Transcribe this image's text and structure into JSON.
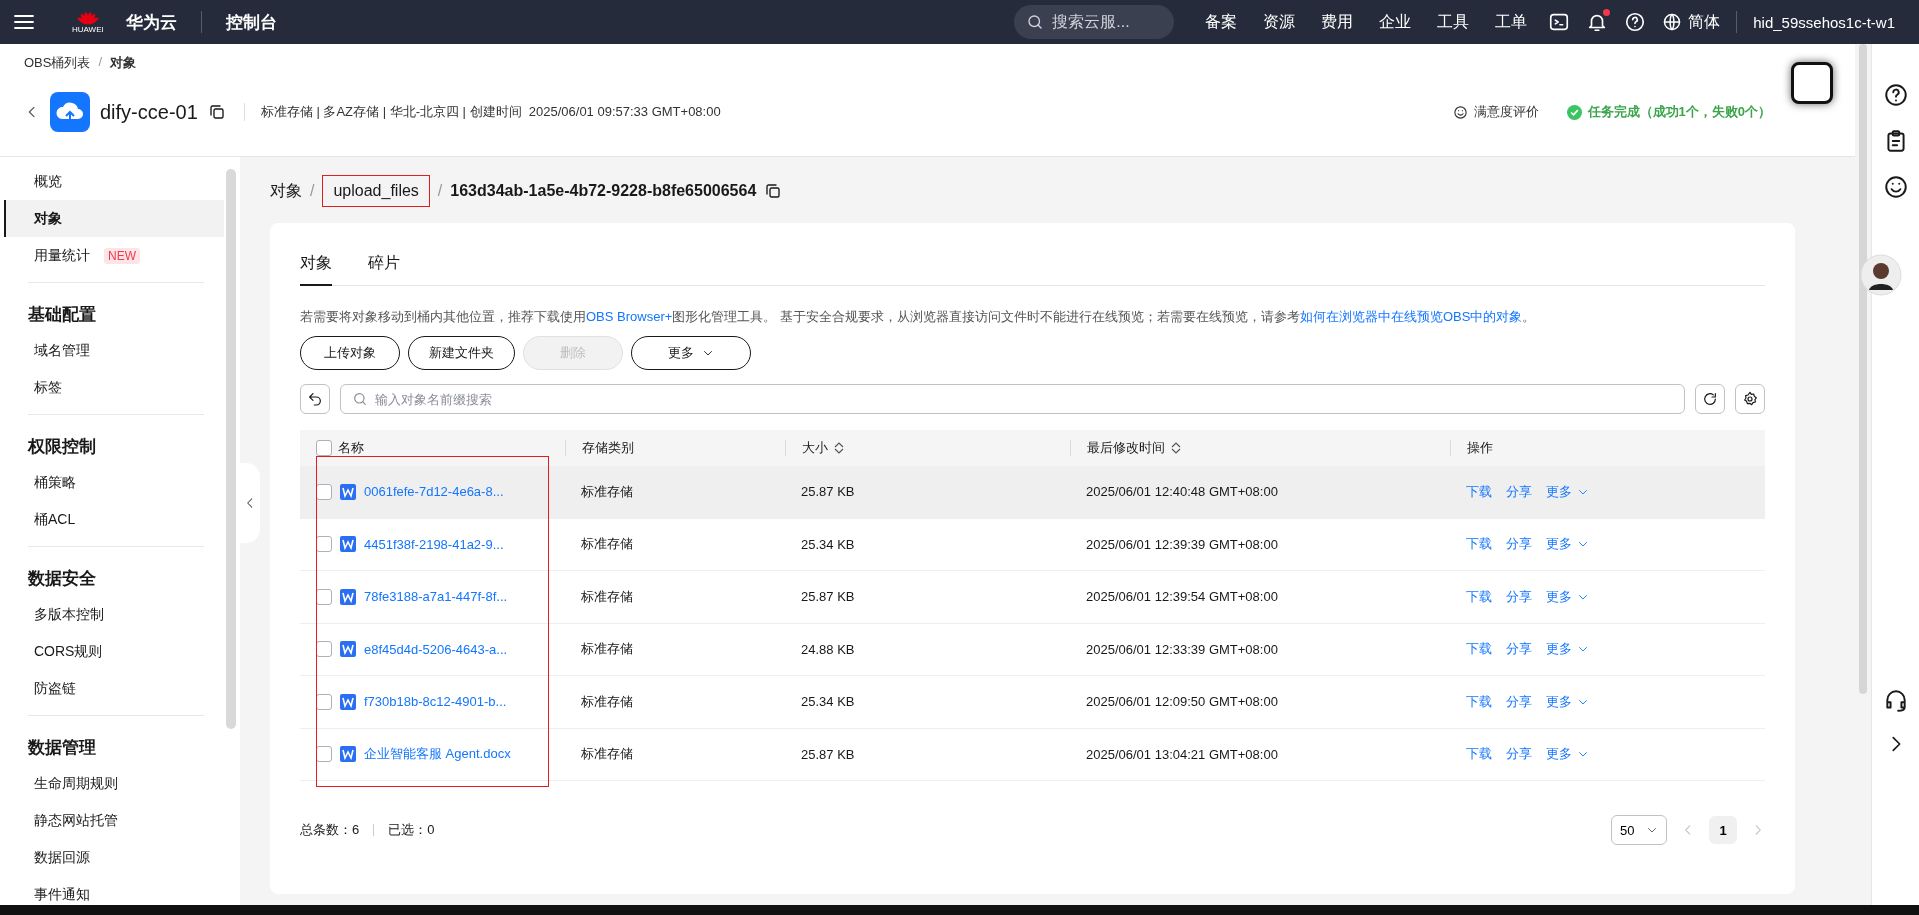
{
  "topbar": {
    "logo_text": "HUAWEI",
    "brand": "华为云",
    "console": "控制台",
    "search_placeholder": "搜索云服...",
    "nav": [
      "备案",
      "资源",
      "费用",
      "企业",
      "工具",
      "工单"
    ],
    "notification_dot": true,
    "language": "简体",
    "user": "hid_59ssehos1c-t-w1"
  },
  "breadcrumb": {
    "separator": "/",
    "items": [
      "OBS桶列表",
      "对象"
    ]
  },
  "bucket": {
    "name": "dify-cce-01",
    "info": "标准存储 | 多AZ存储 | 华北-北京四 | 创建时间  2025/06/01 09:57:33 GMT+08:00",
    "rating": "满意度评价",
    "task_status": "任务完成（成功1个，失败0个）"
  },
  "sidebar": {
    "groups": [
      {
        "items": [
          {
            "label": "概览",
            "selected": false
          },
          {
            "label": "对象",
            "selected": true
          },
          {
            "label": "用量统计",
            "badge": "NEW",
            "selected": false
          }
        ]
      },
      {
        "title": "基础配置",
        "items": [
          {
            "label": "域名管理",
            "selected": false
          },
          {
            "label": "标签",
            "selected": false
          }
        ]
      },
      {
        "title": "权限控制",
        "items": [
          {
            "label": "桶策略",
            "selected": false
          },
          {
            "label": "桶ACL",
            "selected": false
          }
        ]
      },
      {
        "title": "数据安全",
        "items": [
          {
            "label": "多版本控制",
            "selected": false
          },
          {
            "label": "CORS规则",
            "selected": false
          },
          {
            "label": "防盗链",
            "selected": false
          }
        ]
      },
      {
        "title": "数据管理",
        "items": [
          {
            "label": "生命周期规则",
            "selected": false
          },
          {
            "label": "静态网站托管",
            "selected": false
          },
          {
            "label": "数据回源",
            "selected": false
          },
          {
            "label": "事件通知",
            "selected": false
          }
        ]
      }
    ]
  },
  "path": {
    "separator": "/",
    "items": [
      {
        "label": "对象",
        "highlighted": false
      },
      {
        "label": "upload_files",
        "highlighted": true
      },
      {
        "label": "163d34ab-1a5e-4b72-9228-b8fe65006564",
        "highlighted": false
      }
    ]
  },
  "tabs": [
    {
      "label": "对象",
      "selected": true
    },
    {
      "label": "碎片",
      "selected": false
    }
  ],
  "notice": [
    {
      "text": "若需要将对象移动到桶内其他位置，推荐下载使用",
      "link": false
    },
    {
      "text": "OBS Browser+",
      "link": true
    },
    {
      "text": "图形化管理工具。 基于安全合规要求，从浏览器直接访问文件时不能进行在线预览；若需要在线预览，请参考",
      "link": false
    },
    {
      "text": "如何在浏览器中在线预览OBS中的对象",
      "link": true
    },
    {
      "text": "。",
      "link": false
    }
  ],
  "buttons": [
    {
      "label": "上传对象",
      "kind": "button",
      "disabled": false
    },
    {
      "label": "新建文件夹",
      "kind": "button",
      "disabled": false
    },
    {
      "label": "删除",
      "kind": "button",
      "disabled": true
    },
    {
      "label": "更多",
      "kind": "dropdown",
      "disabled": false
    }
  ],
  "search": {
    "placeholder": "输入对象名前缀搜索"
  },
  "table": {
    "name_column_highlighted": true,
    "all_checked": false,
    "columns": [
      {
        "label": "名称",
        "sortable": false
      },
      {
        "label": "存储类别",
        "sortable": false
      },
      {
        "label": "大小",
        "sortable": true
      },
      {
        "label": "最后修改时间",
        "sortable": true
      },
      {
        "label": "操作",
        "sortable": false
      }
    ],
    "rows": [
      {
        "name": "0061fefe-7d12-4e6a-8...",
        "storage": "标准存储",
        "size": "25.87 KB",
        "modified": "2025/06/01 12:40:48 GMT+08:00",
        "actions": [
          "下载",
          "分享",
          "更多"
        ],
        "checked": false,
        "hovered": true
      },
      {
        "name": "4451f38f-2198-41a2-9...",
        "storage": "标准存储",
        "size": "25.34 KB",
        "modified": "2025/06/01 12:39:39 GMT+08:00",
        "actions": [
          "下载",
          "分享",
          "更多"
        ],
        "checked": false,
        "hovered": false
      },
      {
        "name": "78fe3188-a7a1-447f-8f...",
        "storage": "标准存储",
        "size": "25.87 KB",
        "modified": "2025/06/01 12:39:54 GMT+08:00",
        "actions": [
          "下载",
          "分享",
          "更多"
        ],
        "checked": false,
        "hovered": false
      },
      {
        "name": "e8f45d4d-5206-4643-a...",
        "storage": "标准存储",
        "size": "24.88 KB",
        "modified": "2025/06/01 12:33:39 GMT+08:00",
        "actions": [
          "下载",
          "分享",
          "更多"
        ],
        "checked": false,
        "hovered": false
      },
      {
        "name": "f730b18b-8c12-4901-b...",
        "storage": "标准存储",
        "size": "25.34 KB",
        "modified": "2025/06/01 12:09:50 GMT+08:00",
        "actions": [
          "下载",
          "分享",
          "更多"
        ],
        "checked": false,
        "hovered": false
      },
      {
        "name": "企业智能客服 Agent.docx",
        "storage": "标准存储",
        "size": "25.87 KB",
        "modified": "2025/06/01 13:04:21 GMT+08:00",
        "actions": [
          "下载",
          "分享",
          "更多"
        ],
        "checked": false,
        "hovered": false
      }
    ]
  },
  "footer": {
    "total": "总条数：6",
    "selected": "已选：0",
    "page_size": "50",
    "page": "1"
  }
}
